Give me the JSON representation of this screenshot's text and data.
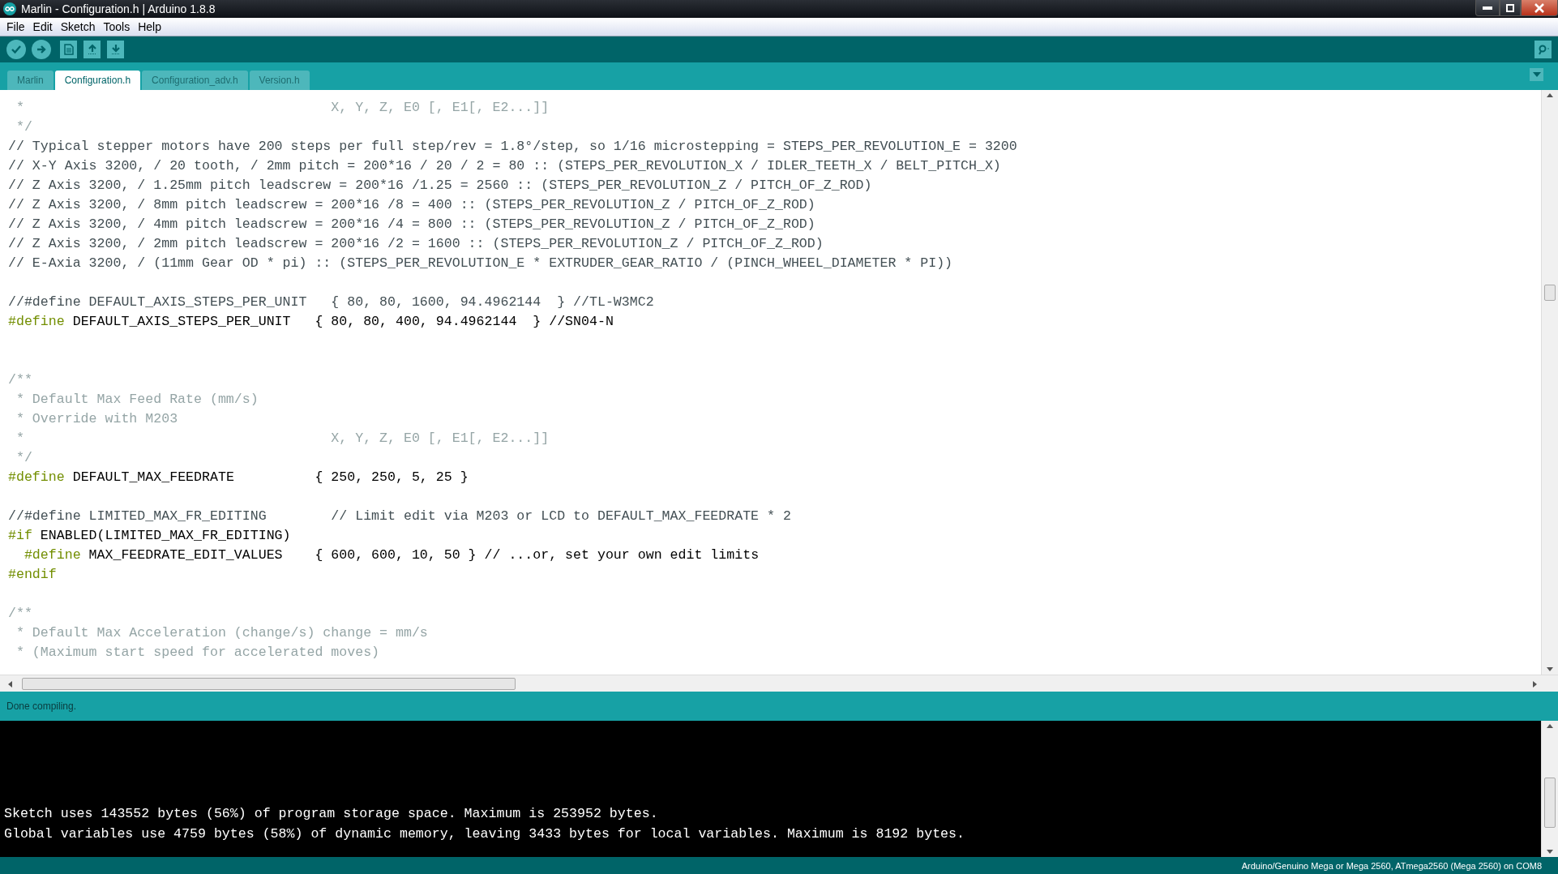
{
  "window": {
    "title": "Marlin - Configuration.h | Arduino 1.8.8"
  },
  "menu": [
    "File",
    "Edit",
    "Sketch",
    "Tools",
    "Help"
  ],
  "tabs": [
    {
      "label": "Marlin",
      "selected": false
    },
    {
      "label": "Configuration.h",
      "selected": true
    },
    {
      "label": "Configuration_adv.h",
      "selected": false
    },
    {
      "label": "Version.h",
      "selected": false
    }
  ],
  "editor": {
    "lines": [
      {
        "kind": "block_comment",
        "text": " *                                      X, Y, Z, E0 [, E1[, E2...]]"
      },
      {
        "kind": "block_comment",
        "text": " */"
      },
      {
        "kind": "line_comment",
        "text": "// Typical stepper motors have 200 steps per full step/rev = 1.8°/step, so 1/16 microstepping = STEPS_PER_REVOLUTION_E = 3200"
      },
      {
        "kind": "line_comment",
        "text": "// X-Y Axis 3200, / 20 tooth, / 2mm pitch = 200*16 / 20 / 2 = 80 :: (STEPS_PER_REVOLUTION_X / IDLER_TEETH_X / BELT_PITCH_X)"
      },
      {
        "kind": "line_comment",
        "text": "// Z Axis 3200, / 1.25mm pitch leadscrew = 200*16 /1.25 = 2560 :: (STEPS_PER_REVOLUTION_Z / PITCH_OF_Z_ROD)"
      },
      {
        "kind": "line_comment",
        "text": "// Z Axis 3200, / 8mm pitch leadscrew = 200*16 /8 = 400 :: (STEPS_PER_REVOLUTION_Z / PITCH_OF_Z_ROD)"
      },
      {
        "kind": "line_comment",
        "text": "// Z Axis 3200, / 4mm pitch leadscrew = 200*16 /4 = 800 :: (STEPS_PER_REVOLUTION_Z / PITCH_OF_Z_ROD)"
      },
      {
        "kind": "line_comment",
        "text": "// Z Axis 3200, / 2mm pitch leadscrew = 200*16 /2 = 1600 :: (STEPS_PER_REVOLUTION_Z / PITCH_OF_Z_ROD)"
      },
      {
        "kind": "line_comment",
        "text": "// E-Axia 3200, / (11mm Gear OD * pi) :: (STEPS_PER_REVOLUTION_E * EXTRUDER_GEAR_RATIO / (PINCH_WHEEL_DIAMETER * PI))"
      },
      {
        "kind": "blank"
      },
      {
        "kind": "line_comment",
        "text": "//#define DEFAULT_AXIS_STEPS_PER_UNIT   { 80, 80, 1600, 94.4962144  } //TL-W3MC2"
      },
      {
        "kind": "directive",
        "keyword": "#define",
        "text": " DEFAULT_AXIS_STEPS_PER_UNIT   { 80, 80, 400, 94.4962144  } //SN04-N"
      },
      {
        "kind": "blank"
      },
      {
        "kind": "blank"
      },
      {
        "kind": "block_comment",
        "text": "/**"
      },
      {
        "kind": "block_comment",
        "text": " * Default Max Feed Rate (mm/s)"
      },
      {
        "kind": "block_comment",
        "text": " * Override with M203"
      },
      {
        "kind": "block_comment",
        "text": " *                                      X, Y, Z, E0 [, E1[, E2...]]"
      },
      {
        "kind": "block_comment",
        "text": " */"
      },
      {
        "kind": "directive",
        "keyword": "#define",
        "text": " DEFAULT_MAX_FEEDRATE          { 250, 250, 5, 25 }"
      },
      {
        "kind": "blank"
      },
      {
        "kind": "line_comment",
        "text": "//#define LIMITED_MAX_FR_EDITING        // Limit edit via M203 or LCD to DEFAULT_MAX_FEEDRATE * 2"
      },
      {
        "kind": "directive",
        "keyword": "#if",
        "text": " ENABLED(LIMITED_MAX_FR_EDITING)"
      },
      {
        "kind": "directive",
        "keyword": "  #define",
        "text": " MAX_FEEDRATE_EDIT_VALUES    { 600, 600, 10, 50 } // ...or, set your own edit limits"
      },
      {
        "kind": "directive",
        "keyword": "#endif"
      },
      {
        "kind": "blank"
      },
      {
        "kind": "block_comment",
        "text": "/**"
      },
      {
        "kind": "block_comment",
        "text": " * Default Max Acceleration (change/s) change = mm/s"
      },
      {
        "kind": "block_comment",
        "text": " * (Maximum start speed for accelerated moves)"
      }
    ]
  },
  "status": {
    "message": "Done compiling."
  },
  "console": {
    "lines": [
      "Sketch uses 143552 bytes (56%) of program storage space. Maximum is 253952 bytes.",
      "Global variables use 4759 bytes (58%) of dynamic memory, leaving 3433 bytes for local variables. Maximum is 8192 bytes."
    ]
  },
  "board_status": "Arduino/Genuino Mega or Mega 2560, ATmega2560 (Mega 2560) on COM8"
}
